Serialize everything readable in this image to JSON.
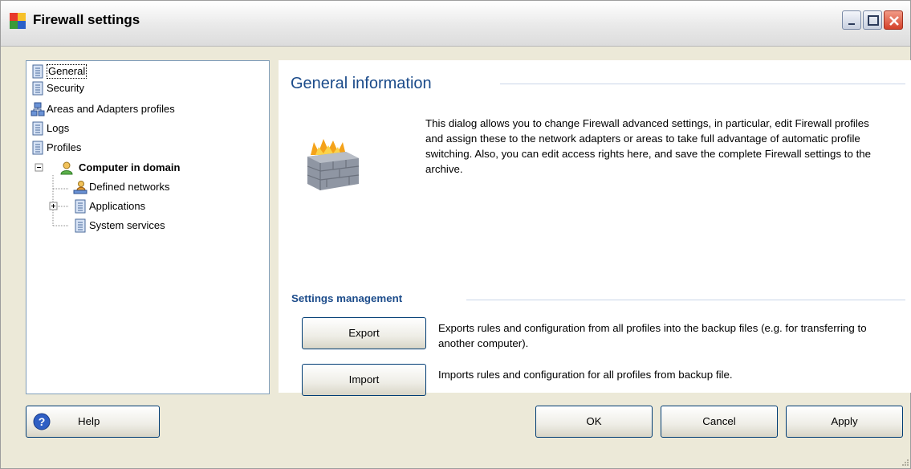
{
  "window": {
    "title": "Firewall settings"
  },
  "tree": [
    {
      "label": "General",
      "icon": "list-icon",
      "selected": true
    },
    {
      "label": "Security",
      "icon": "list-icon"
    },
    {
      "label": "Areas and Adapters profiles",
      "icon": "network-icon"
    },
    {
      "label": "Logs",
      "icon": "list-icon"
    },
    {
      "label": "Profiles",
      "icon": "list-icon"
    },
    {
      "label": "Computer in domain",
      "icon": "user-icon",
      "expanded": true
    },
    {
      "label": "Defined networks",
      "icon": "network-user-icon"
    },
    {
      "label": "Applications",
      "icon": "list-icon",
      "collapsed": true
    },
    {
      "label": "System services",
      "icon": "list-icon"
    }
  ],
  "general": {
    "heading": "General information",
    "description": "This dialog allows you to change Firewall advanced settings, in particular, edit Firewall profiles and assign these to the network adapters or areas to take full advantage of automatic profile switching. Also, you can edit access rights here, and save the complete Firewall settings to the archive."
  },
  "settings": {
    "heading": "Settings management",
    "export_label": "Export",
    "export_desc": "Exports rules and configuration from all profiles into the backup files (e.g. for transferring to another computer).",
    "import_label": "Import",
    "import_desc": "Imports rules and configuration for all profiles from backup file."
  },
  "footer": {
    "help_label": "Help",
    "ok_label": "OK",
    "cancel_label": "Cancel",
    "apply_label": "Apply"
  },
  "colors": {
    "heading": "#1b4b8a",
    "dialog_bg": "#ece9d8",
    "button_border": "#003c74"
  }
}
